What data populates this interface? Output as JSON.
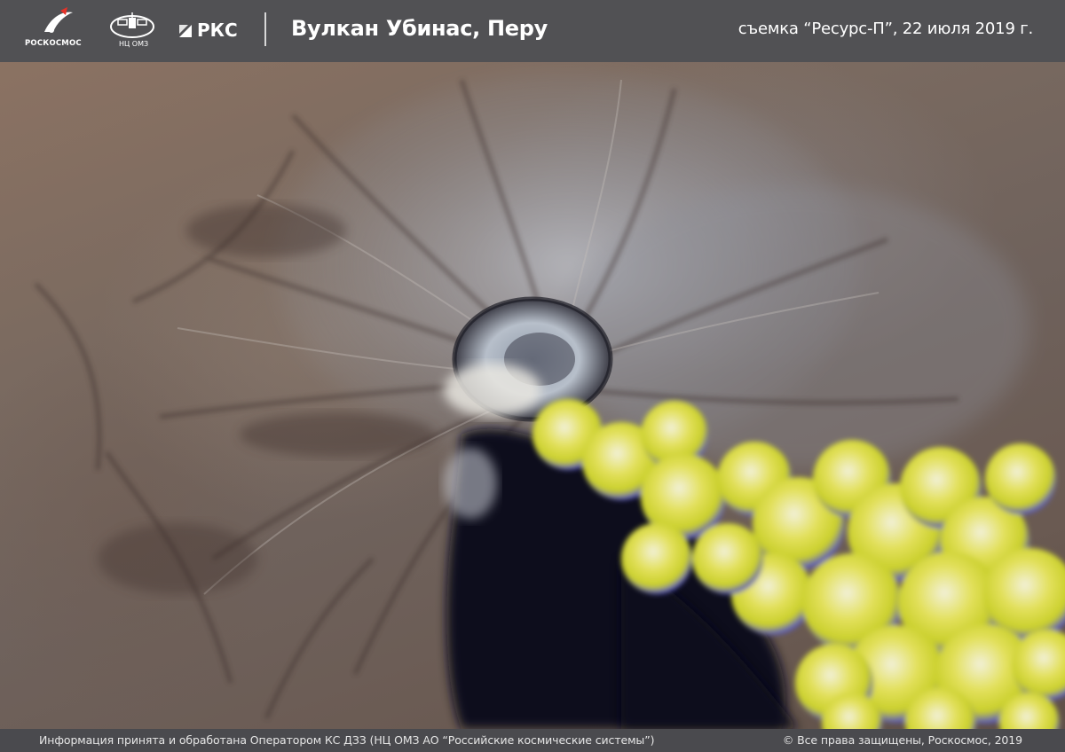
{
  "header": {
    "logos": {
      "roscosmos": {
        "text": "РОСКОСМОС",
        "icon": "roscosmos-logo"
      },
      "nts_omz": {
        "text": "НЦ ОМЗ",
        "icon": "satellite-logo"
      },
      "rks": {
        "text": "РКС",
        "icon": "rks-logo"
      }
    },
    "title": "Вулкан Убинас, Перу",
    "capture_info": "съемка “Ресурс-П”, 22 июля 2019 г."
  },
  "image": {
    "subject": "satellite-image",
    "colors": {
      "terrain": "#7a6a60",
      "plume_shadow": "#0d0d1a",
      "plume_yellow": "#d8dc3c",
      "plume_blue": "#6a6ad8",
      "crater": "#a8b0bc"
    }
  },
  "footer": {
    "info": "Информация принята и обработана Оператором КС ДЗЗ (НЦ ОМЗ АО “Российские космические системы”)",
    "copyright": "© Все права защищены, Роскосмос, 2019"
  },
  "theme": {
    "bar_color": "#515154",
    "text_color": "#ffffff"
  }
}
